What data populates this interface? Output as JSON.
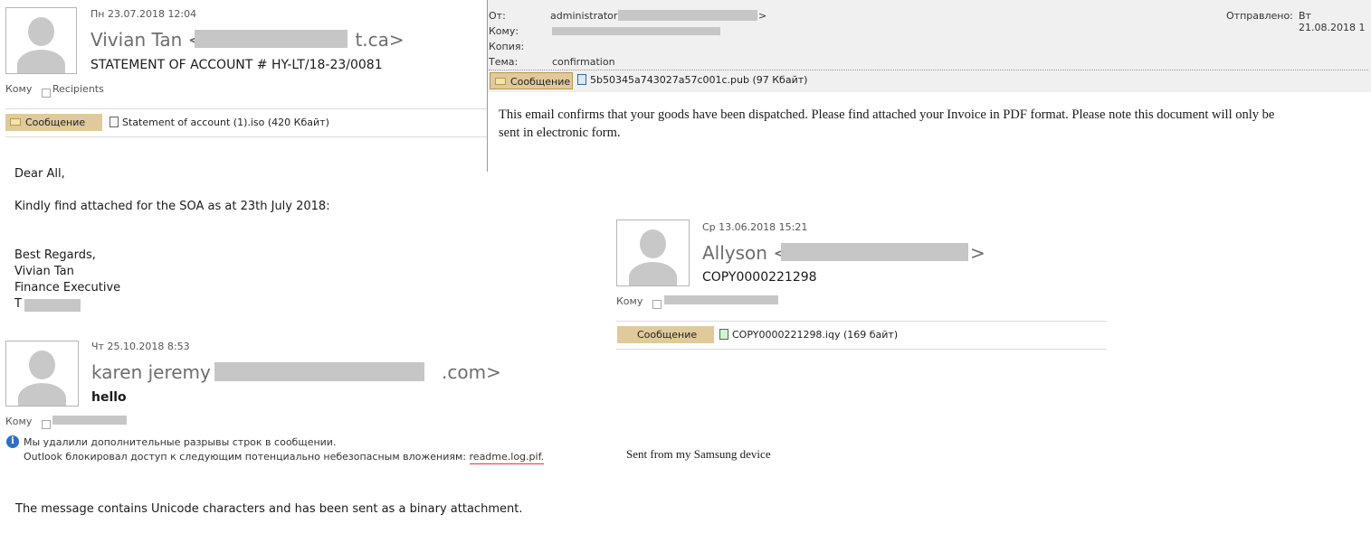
{
  "email1": {
    "date": "Пн 23.07.2018 12:04",
    "sender_name": "Vivian Tan <",
    "sender_domain_suffix": "t.ca>",
    "subject": "STATEMENT OF ACCOUNT # HY-LT/18-23/0081",
    "to_label": "Кому",
    "recipients_label": "Recipients",
    "message_tab": "Сообщение",
    "attachment": "Statement of account (1).iso (420 Кбайт)",
    "body": {
      "greeting": "Dear All,",
      "line1": "Kindly find attached for the SOA as at 23th July 2018:",
      "regards": "Best Regards,",
      "name": "Vivian Tan",
      "title": "Finance Executive",
      "tel_prefix": "T"
    }
  },
  "email2": {
    "from_label": "От:",
    "from_value": "administrator <",
    "from_close": ">",
    "to_label": "Кому:",
    "cc_label": "Копия:",
    "subject_label": "Тема:",
    "subject_value": "confirmation",
    "sent_label": "Отправлено:",
    "sent_value": "Вт 21.08.2018 1",
    "message_tab": "Сообщение",
    "attachment": "5b50345a743027a57c001c.pub (97 Кбайт)",
    "body_line1": "This email confirms that your goods have been dispatched. Please find attached your Invoice in PDF format. Please note this document will only be",
    "body_line2": "sent in electronic form."
  },
  "email3": {
    "date": "Ср 13.06.2018 15:21",
    "sender_name": "Allyson <",
    "sender_close": ">",
    "subject": "COPY0000221298",
    "to_label": "Кому",
    "message_tab": "Сообщение",
    "attachment": "COPY0000221298.iqy (169 байт)",
    "body": "Sent from my Samsung device"
  },
  "email4": {
    "date": "Чт 25.10.2018 8:53",
    "sender_name": "karen jeremy <",
    "sender_domain_suffix": ".com>",
    "subject": "hello",
    "to_label": "Кому",
    "info_line1": "Мы удалили дополнительные разрывы строк в сообщении.",
    "info_line2_prefix": "Outlook блокировал доступ к следующим потенциально небезопасным вложениям:",
    "blocked_attachment": "readme.log.pif.",
    "body": "The message contains Unicode characters and has been sent as a binary attachment."
  },
  "colors": {
    "message_tab_bg": "#e0ca9b",
    "redaction": "#c6c6c6",
    "header_panel_bg": "#f0f0f0",
    "info_icon": "#2e6fc0",
    "underline_red": "#d43b3b"
  }
}
